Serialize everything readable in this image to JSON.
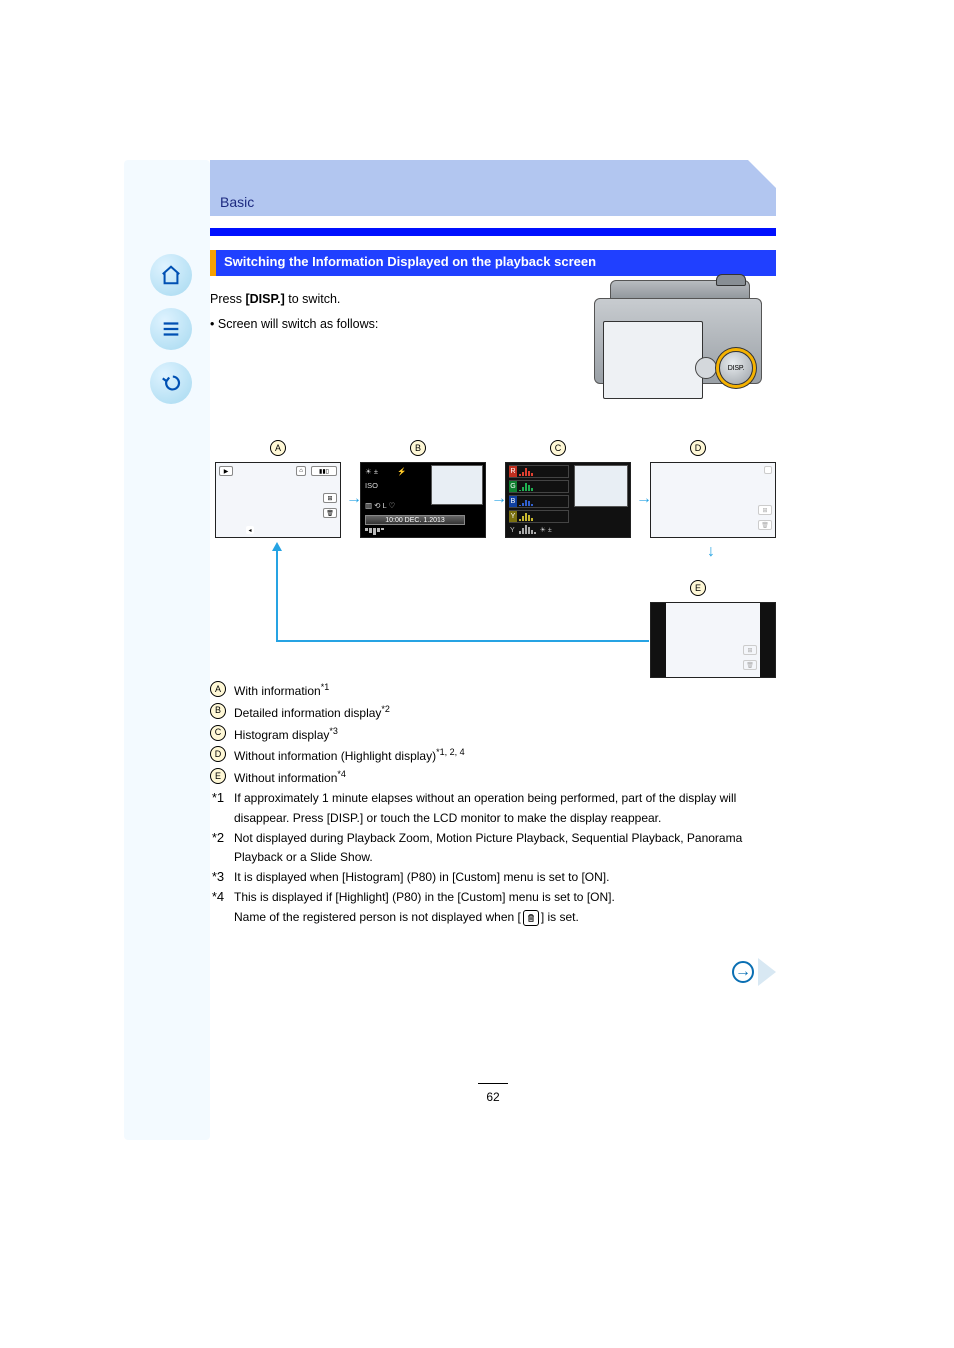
{
  "header": {
    "category": "Basic",
    "title": "Switching the Information Displayed on the playback screen"
  },
  "sidebar": {
    "home": "home-icon",
    "menu": "menu-icon",
    "back": "back-icon"
  },
  "intro": {
    "line1": "Press ",
    "disp": "[DISP.]",
    "line2": " to switch.",
    "bullet": "Screen will switch as follows:"
  },
  "camera_button_label": "DISP.",
  "diagram": {
    "labelA": "A",
    "labelB": "B",
    "labelC": "C",
    "labelD": "D",
    "labelE": "E",
    "info_time": "10:00  DEC.  1.2013",
    "hist_labels": [
      "R",
      "G",
      "B",
      "Y"
    ],
    "exp_sym": "±"
  },
  "list": {
    "A": {
      "label": "A",
      "text": "With information",
      "notes": "*1"
    },
    "B": {
      "label": "B",
      "text": "Detailed information display",
      "notes": "*2"
    },
    "C": {
      "label": "C",
      "text": "Histogram display",
      "notes": "*3"
    },
    "D": {
      "label": "D",
      "text": "Without information (Highlight display)",
      "notes": "*1, 2, 4"
    },
    "E": {
      "label": "E",
      "text": "Without information",
      "notes": "*4"
    },
    "n1": {
      "ast": "*1",
      "text": "If approximately 1 minute elapses without an operation being performed, part of the display will disappear. Press [DISP.] or touch the LCD monitor to make the display reappear."
    },
    "n2": {
      "ast": "*2",
      "text": "Not displayed during Playback Zoom, Motion Picture Playback, Sequential Playback, Panorama Playback or a Slide Show."
    },
    "n3": {
      "ast": "*3",
      "text": "It is displayed when [Histogram] (P80) in [Custom] menu is set to [ON]."
    },
    "n4": {
      "ast": "*4",
      "pre": "This is displayed if [Highlight] (P80) in the [Custom] menu is set to [ON].\nName of the registered person is not displayed when [",
      "post": "] is set."
    }
  },
  "chart_data": {
    "type": "bar",
    "title": "Histogram display",
    "series": [
      {
        "name": "R",
        "values": [
          2,
          4,
          8,
          12,
          9,
          5,
          3,
          1
        ]
      },
      {
        "name": "G",
        "values": [
          1,
          3,
          7,
          11,
          10,
          6,
          4,
          2
        ]
      },
      {
        "name": "B",
        "values": [
          1,
          2,
          5,
          9,
          8,
          5,
          3,
          1
        ]
      },
      {
        "name": "Y",
        "values": [
          2,
          5,
          9,
          12,
          10,
          6,
          3,
          1
        ]
      }
    ],
    "xlabel": "",
    "ylabel": ""
  },
  "page_number": "62"
}
